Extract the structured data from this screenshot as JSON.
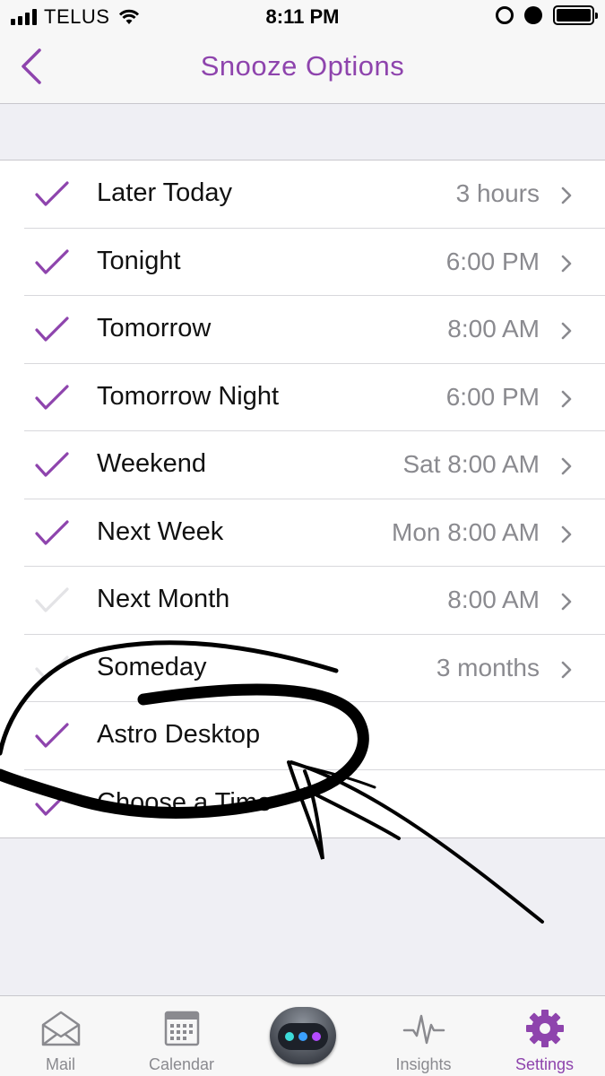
{
  "status_bar": {
    "carrier": "TELUS",
    "time": "8:11 PM",
    "icons": [
      "signal-icon",
      "wifi-icon",
      "rotation-lock-icon",
      "alarm-icon",
      "battery-icon"
    ]
  },
  "nav": {
    "title": "Snooze Options",
    "back_icon": "chevron-left-icon"
  },
  "snooze_options": [
    {
      "label": "Later Today",
      "value": "3 hours",
      "checked": true
    },
    {
      "label": "Tonight",
      "value": "6:00 PM",
      "checked": true
    },
    {
      "label": "Tomorrow",
      "value": "8:00 AM",
      "checked": true
    },
    {
      "label": "Tomorrow Night",
      "value": "6:00 PM",
      "checked": true
    },
    {
      "label": "Weekend",
      "value": "Sat 8:00 AM",
      "checked": true
    },
    {
      "label": "Next Week",
      "value": "Mon 8:00 AM",
      "checked": true
    },
    {
      "label": "Next Month",
      "value": "8:00 AM",
      "checked": false
    },
    {
      "label": "Someday",
      "value": "3 months",
      "checked": false
    },
    {
      "label": "Astro Desktop",
      "value": "",
      "checked": true
    },
    {
      "label": "Choose a Time",
      "value": "",
      "checked": true
    }
  ],
  "tab_bar": {
    "tabs": [
      {
        "label": "Mail",
        "icon": "mail-icon",
        "active": false
      },
      {
        "label": "Calendar",
        "icon": "calendar-icon",
        "active": false
      },
      {
        "label": "",
        "icon": "astro-bot-icon",
        "active": false
      },
      {
        "label": "Insights",
        "icon": "pulse-icon",
        "active": false
      },
      {
        "label": "Settings",
        "icon": "gear-icon",
        "active": true
      }
    ]
  },
  "colors": {
    "accent": "#8e44ad",
    "checked": "#8e44ad",
    "unchecked": "#e3e3e6",
    "secondary_text": "#8a8a8f",
    "background": "#efeff4"
  }
}
